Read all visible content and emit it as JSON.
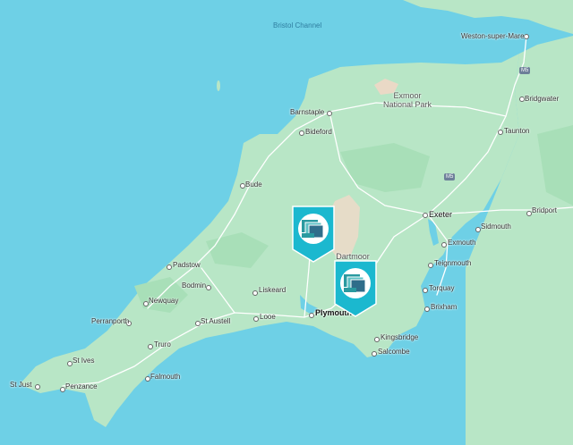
{
  "sea_label": "Bristol Channel",
  "places": [
    {
      "id": "weston-super-mare",
      "name": "Weston-super-Mare"
    },
    {
      "id": "bridgwater",
      "name": "Bridgwater"
    },
    {
      "id": "taunton",
      "name": "Taunton"
    },
    {
      "id": "barnstaple",
      "name": "Barnstaple"
    },
    {
      "id": "bideford",
      "name": "Bideford"
    },
    {
      "id": "bude",
      "name": "Bude"
    },
    {
      "id": "exeter",
      "name": "Exeter"
    },
    {
      "id": "bridport",
      "name": "Bridport"
    },
    {
      "id": "sidmouth",
      "name": "Sidmouth"
    },
    {
      "id": "exmouth",
      "name": "Exmouth"
    },
    {
      "id": "teignmouth",
      "name": "Teignmouth"
    },
    {
      "id": "torquay",
      "name": "Torquay"
    },
    {
      "id": "brixham",
      "name": "Brixham"
    },
    {
      "id": "kingsbridge",
      "name": "Kingsbridge"
    },
    {
      "id": "salcombe",
      "name": "Salcombe"
    },
    {
      "id": "plymouth",
      "name": "Plymouth"
    },
    {
      "id": "liskeard",
      "name": "Liskeard"
    },
    {
      "id": "looe",
      "name": "Looe"
    },
    {
      "id": "padstow",
      "name": "Padstow"
    },
    {
      "id": "bodmin",
      "name": "Bodmin"
    },
    {
      "id": "newquay",
      "name": "Newquay"
    },
    {
      "id": "st-austell",
      "name": "St Austell"
    },
    {
      "id": "perranporth",
      "name": "Perranporth"
    },
    {
      "id": "truro",
      "name": "Truro"
    },
    {
      "id": "st-ives",
      "name": "St Ives"
    },
    {
      "id": "falmouth",
      "name": "Falmouth"
    },
    {
      "id": "st-just",
      "name": "St Just"
    },
    {
      "id": "penzance",
      "name": "Penzance"
    }
  ],
  "parks": [
    {
      "id": "exmoor",
      "name": "Exmoor\nNational Park"
    },
    {
      "id": "dartmoor",
      "name": "Dartmoor\nN"
    }
  ],
  "road_shields": [
    {
      "id": "m5-north",
      "label": "M5"
    },
    {
      "id": "m5-south",
      "label": "M5"
    }
  ],
  "markers": [
    {
      "id": "marker-1",
      "icon": "layered-panels-icon",
      "color": "#1bb8cf"
    },
    {
      "id": "marker-2",
      "icon": "layered-panels-icon",
      "color": "#1bb8cf"
    }
  ],
  "colors": {
    "sea": "#6ed0e6",
    "land": "#b8e6c6",
    "land_dark": "#9edab0",
    "moor": "#e8dcc8",
    "road": "#ffffff"
  }
}
